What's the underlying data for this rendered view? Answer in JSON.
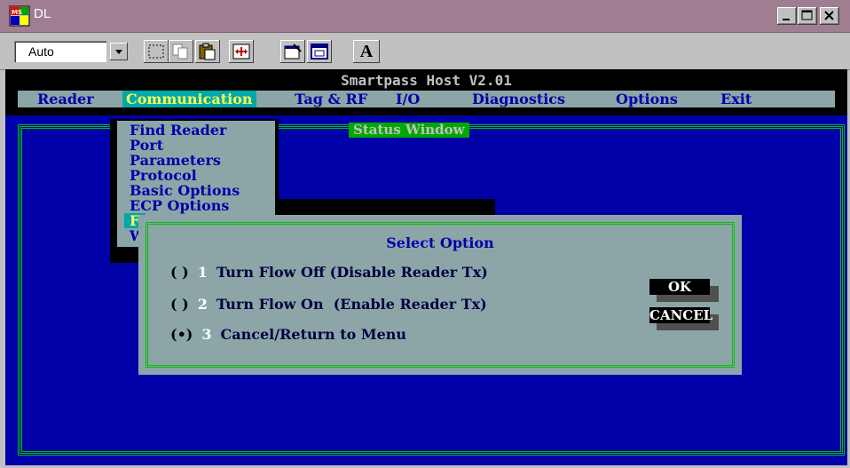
{
  "window": {
    "title": "DL",
    "app_icon": "ms-dos-icon",
    "controls": [
      "minimize",
      "maximize",
      "close"
    ]
  },
  "toolbar": {
    "font_size_value": "Auto",
    "buttons": [
      "mark",
      "copy",
      "paste",
      "full-screen",
      "properties",
      "background",
      "font"
    ],
    "font_button_label": "A"
  },
  "console": {
    "app_title": "Smartpass Host V2.01",
    "menu": [
      {
        "label": "Reader",
        "active": false
      },
      {
        "label": "Communication",
        "active": true
      },
      {
        "label": "Tag & RF",
        "active": false
      },
      {
        "label": "I/O",
        "active": false
      },
      {
        "label": "Diagnostics",
        "active": false
      },
      {
        "label": "Options",
        "active": false
      },
      {
        "label": "Exit",
        "active": false
      }
    ],
    "status_window_label": "Status Window",
    "dropdown": {
      "items": [
        "Find Reader",
        "Port",
        "Parameters",
        "Protocol",
        "Basic Options",
        "ECP Options",
        "F",
        "W"
      ],
      "selected_index": 6
    },
    "dialog": {
      "title": "Select Option",
      "options": [
        {
          "radio": "( )",
          "number": "1",
          "text": "Turn Flow Off (Disable Reader Tx)",
          "selected": false
        },
        {
          "radio": "( )",
          "number": "2",
          "text": "Turn Flow On  (Enable Reader Tx)",
          "selected": false
        },
        {
          "radio": "(•)",
          "number": "3",
          "text": "Cancel/Return to Menu",
          "selected": true
        }
      ],
      "ok_label": "OK",
      "cancel_label": "CANCEL"
    },
    "colors": {
      "background": "#0000a8",
      "menu_bg": "#8ca6a8",
      "highlight": "#00a8a8",
      "border": "#00c000"
    }
  }
}
